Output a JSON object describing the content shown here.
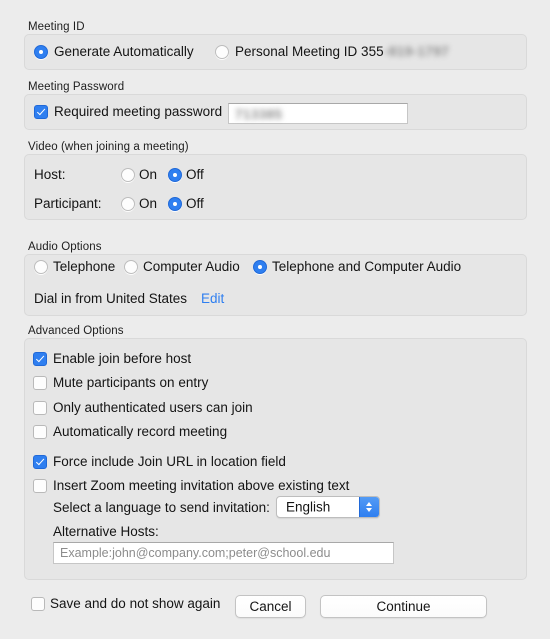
{
  "sections": {
    "meeting_id": {
      "label": "Meeting ID",
      "generate_label": "Generate Automatically",
      "personal_label": "Personal Meeting ID 355",
      "personal_redacted": "-819-1797"
    },
    "meeting_password": {
      "label": "Meeting Password",
      "required_label": "Required meeting password",
      "password_value": "713385"
    },
    "video": {
      "label": "Video (when joining a meeting)",
      "host_label": "Host:",
      "participant_label": "Participant:",
      "on_label": "On",
      "off_label": "Off"
    },
    "audio": {
      "label": "Audio Options",
      "telephone_label": "Telephone",
      "computer_audio_label": "Computer Audio",
      "both_label": "Telephone and Computer Audio",
      "dial_in_label": "Dial in from United States",
      "edit_link": "Edit"
    },
    "advanced": {
      "label": "Advanced Options",
      "join_before_host": "Enable join before host",
      "mute_participants": "Mute participants on entry",
      "only_authenticated": "Only authenticated users can join",
      "auto_record": "Automatically record meeting",
      "force_join_url": "Force include Join URL in location field",
      "insert_invitation": "Insert Zoom meeting invitation above existing text",
      "language_label": "Select a language to send invitation:",
      "language_value": "English",
      "alt_hosts_label": "Alternative Hosts:",
      "alt_hosts_placeholder": "Example:john@company.com;peter@school.edu"
    }
  },
  "footer": {
    "save_label": "Save and do not show again",
    "cancel_label": "Cancel",
    "continue_label": "Continue"
  },
  "colors": {
    "accent": "#2f7ff0",
    "window_bg": "#ececec",
    "group_bg": "#e6e6e6"
  }
}
